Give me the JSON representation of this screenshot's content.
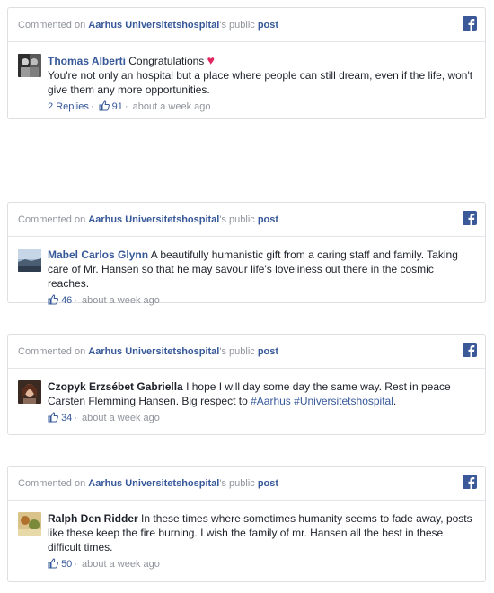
{
  "cards": [
    {
      "prefix": "Commented on ",
      "page_name": "Aarhus Universitetshospital",
      "possessive": "'s public ",
      "post_link": "post",
      "author": "Thomas Alberti",
      "text": " Congratulations",
      "text2": "You're not only an hospital but a place where people can still dream, even if the life, won't give them any more opportunities.",
      "replies": "2 Replies",
      "likes": "91",
      "time": "about a week ago"
    },
    {
      "prefix": "Commented on ",
      "page_name": "Aarhus Universitetshospital",
      "possessive": "'s public ",
      "post_link": "post",
      "author": "Mabel Carlos Glynn",
      "text": " A beautifully humanistic gift from a caring staff and family. Taking care of Mr. Hansen so that he may savour life's loveliness out there in the cosmic reaches.",
      "likes": "46",
      "time": "about a week ago"
    },
    {
      "prefix": "Commented on ",
      "page_name": "Aarhus Universitetshospital",
      "possessive": "'s public ",
      "post_link": "post",
      "author": "Czopyk Erzsébet Gabriella",
      "text": " I hope I will day some day the same way. Rest in peace Carsten Flemming Hansen. Big respect to ",
      "hashtag1": "#Aarhus",
      "hashtag2": "#Universitetshospital",
      "text_end": ".",
      "likes": "34",
      "time": "about a week ago"
    },
    {
      "prefix": "Commented on ",
      "page_name": "Aarhus Universitetshospital",
      "possessive": "'s public ",
      "post_link": "post",
      "author": "Ralph Den Ridder",
      "text": " In these times where sometimes humanity seems to fade away, posts like these keep the fire burning. I wish the family of mr. Hansen all the best in these difficult times.",
      "likes": "50",
      "time": "about a week ago"
    }
  ],
  "separator": "·",
  "icons": {
    "facebook": "facebook-icon",
    "like": "thumbs-up-icon",
    "heart": "heart-icon"
  },
  "colors": {
    "link": "#365899",
    "facebook": "#3b5998",
    "meta": "#90949c",
    "heart": "#e0245e"
  }
}
